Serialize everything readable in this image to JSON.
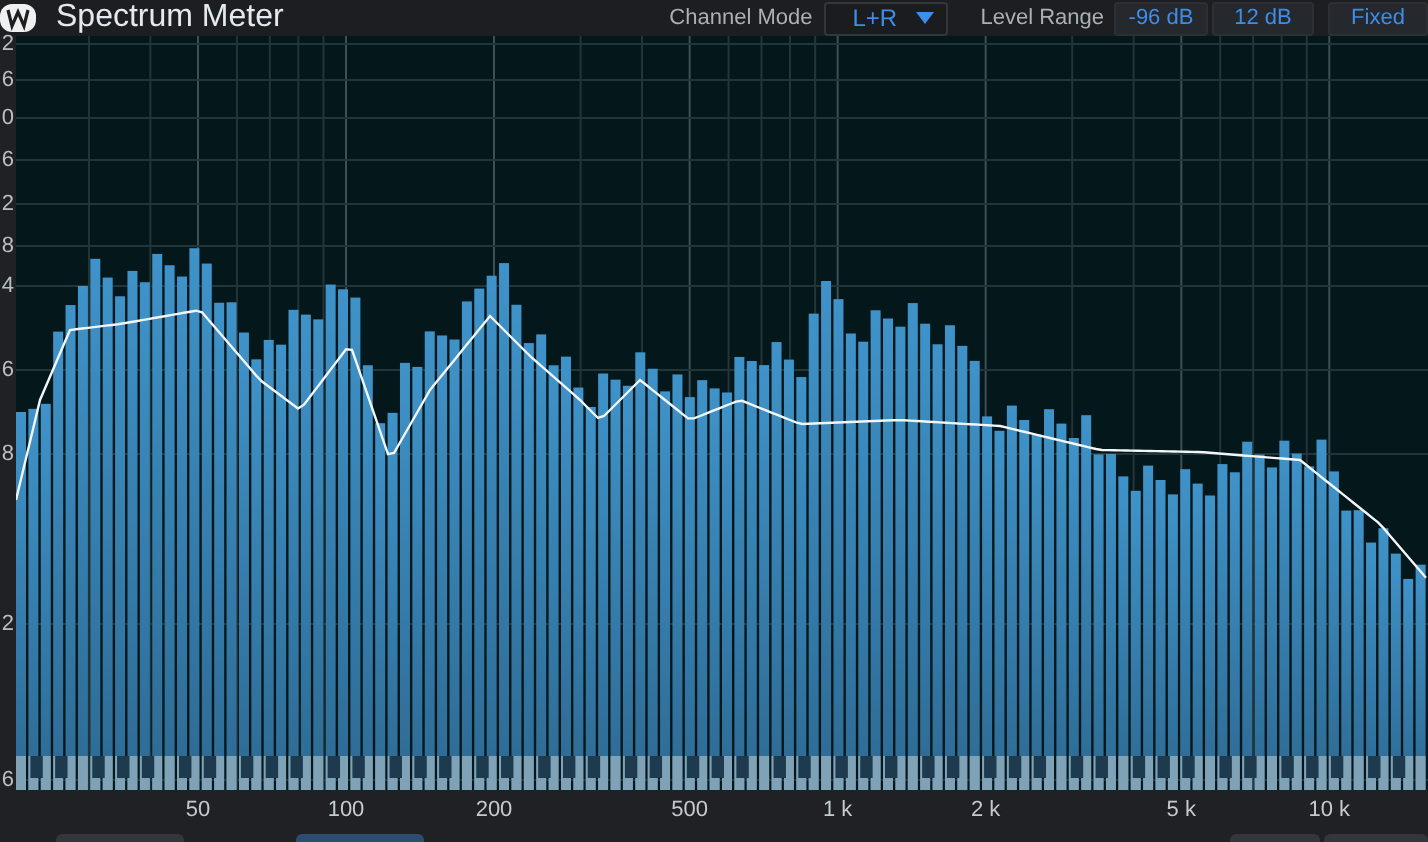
{
  "header": {
    "title": "Spectrum Meter",
    "channel_mode": {
      "label": "Channel Mode",
      "value": "L+R"
    },
    "level_range": {
      "label": "Level Range",
      "min": "-96 dB",
      "max": "12 dB",
      "mode": "Fixed"
    }
  },
  "y_axis_labels": [
    "2",
    "6",
    "0",
    "6",
    "2",
    "8",
    "4",
    "6",
    "8",
    "2",
    "6"
  ],
  "x_axis_labels": [
    "50",
    "100",
    "200",
    "500",
    "1 k",
    "2 k",
    "5 k",
    "10 k"
  ],
  "bottom_tabs": [
    {
      "selected": false
    },
    {
      "selected": true
    },
    {
      "selected": false
    },
    {
      "selected": false
    }
  ]
}
